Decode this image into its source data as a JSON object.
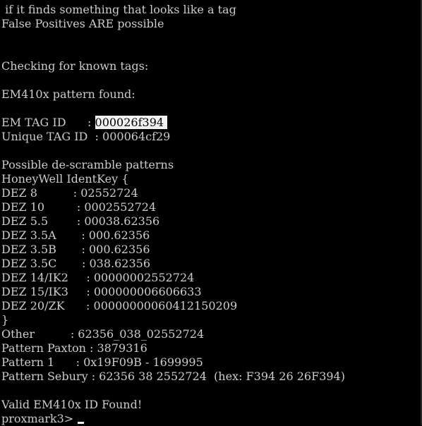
{
  "terminal": {
    "lines": [
      " if it finds something that looks like a tag",
      "False Positives ARE possible",
      "",
      "",
      "Checking for known tags:",
      "",
      "EM410x pattern found:",
      "",
      "EM TAG ID      : ",
      "Unique TAG ID  : 000064cf29",
      "",
      "Possible de-scramble patterns",
      "HoneyWell IdentKey {",
      "DEZ 8          : 02552724",
      "DEZ 10         : 0002552724",
      "DEZ 5.5        : 00038.62356",
      "DEZ 3.5A       : 000.62356",
      "DEZ 3.5B       : 000.62356",
      "DEZ 3.5C       : 038.62356",
      "DEZ 14/IK2     : 00000002552724",
      "DEZ 15/IK3     : 000000006606633",
      "DEZ 20/ZK      : 00000000060412150209",
      "}",
      "Other          : 62356_038_02552724",
      "Pattern Paxton : 3879316",
      "Pattern 1      : 0x19F09B - 1699995",
      "Pattern Sebury : 62356 38 2552724  (hex: F394 26 26F394)",
      "",
      "Valid EM410x ID Found!"
    ],
    "em_tag_id_selected": "000026f394 ",
    "prompt": "proxmark3>"
  }
}
